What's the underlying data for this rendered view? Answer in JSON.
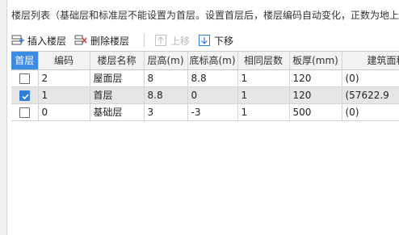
{
  "panel": {
    "title": "楼层列表（基础层和标准层不能设置为首层。设置首层后，楼层编码自动变化，正数为地上层，负数为地下层）"
  },
  "toolbar": {
    "insert_label": "插入楼层",
    "delete_label": "删除楼层",
    "up_label": "上移",
    "down_label": "下移",
    "insert_icon": "insert-floor-icon",
    "delete_icon": "delete-floor-icon",
    "up_icon": "move-up-icon",
    "down_icon": "move-down-icon"
  },
  "table": {
    "columns": [
      "首层",
      "编码",
      "楼层名称",
      "层高(m)",
      "底标高(m)",
      "相同层数",
      "板厚(mm)",
      "建筑面积"
    ],
    "rows": [
      {
        "first_floor": false,
        "code": "2",
        "name": "屋面层",
        "height": "8",
        "base_elevation": "8.8",
        "same_count": "1",
        "slab_thickness": "120",
        "area": "(0)"
      },
      {
        "first_floor": true,
        "code": "1",
        "name": "首层",
        "height": "8.8",
        "base_elevation": "0",
        "same_count": "1",
        "slab_thickness": "120",
        "area": "(57622.9"
      },
      {
        "first_floor": false,
        "code": "0",
        "name": "基础层",
        "height": "3",
        "base_elevation": "-3",
        "same_count": "1",
        "slab_thickness": "500",
        "area": "(0)"
      }
    ]
  },
  "colors": {
    "accent": "#3c8ce6",
    "checkbox_on": "#2f7fe0",
    "selected_row": "#e6e6e6",
    "delete_icon": "#d23c3c"
  }
}
